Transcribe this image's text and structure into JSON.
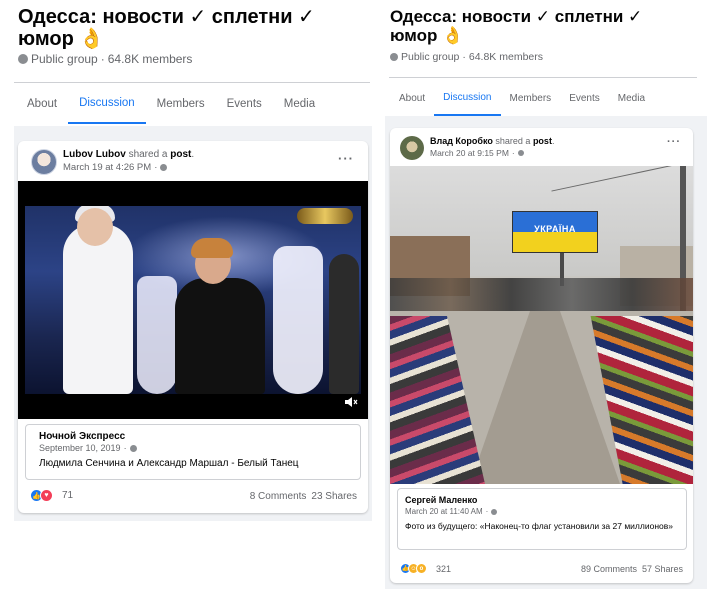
{
  "left": {
    "group": {
      "title": "Одесса: новости ✓ сплетни ✓ юмор 👌",
      "privacy": "Public group",
      "separator": "·",
      "members": "64.8K members"
    },
    "tabs": [
      {
        "label": "About",
        "active": false
      },
      {
        "label": "Discussion",
        "active": true
      },
      {
        "label": "Members",
        "active": false
      },
      {
        "label": "Events",
        "active": false
      },
      {
        "label": "Media",
        "active": false
      }
    ],
    "post": {
      "author": "Lubov Lubov",
      "shared_text": "shared a",
      "post_word": "post",
      "period": ".",
      "time": "March 19 at 4:26 PM",
      "time_separator": "·",
      "more": "···",
      "shared_post": {
        "author": "Ночной Экспресс",
        "date": "September 10, 2019",
        "date_separator": "·",
        "text": "Людмила Сенчина и Александр Маршал - Белый Танец"
      },
      "reactions_count": "71",
      "comments": "8 Comments",
      "shares": "23 Shares"
    }
  },
  "right": {
    "group": {
      "title": "Одесса: новости ✓ сплетни ✓ юмор 👌",
      "privacy": "Public group",
      "separator": "·",
      "members": "64.8K members"
    },
    "tabs": [
      {
        "label": "About",
        "active": false
      },
      {
        "label": "Discussion",
        "active": true
      },
      {
        "label": "Members",
        "active": false
      },
      {
        "label": "Events",
        "active": false
      },
      {
        "label": "Media",
        "active": false
      }
    ],
    "post": {
      "author": "Влад Коробко",
      "shared_text": "shared a",
      "post_word": "post",
      "period": ".",
      "time": "March 20 at 9:15 PM",
      "time_separator": "·",
      "more": "···",
      "photo_billboard_text": "УКРАЇНА",
      "shared_post": {
        "author": "Сергей Маленко",
        "date": "March 20 at 11:40 AM",
        "date_separator": "·",
        "text": "Фото из будущего: «Наконец-то флаг установили за 27 миллионов»"
      },
      "reactions_count": "321",
      "comments": "89 Comments",
      "shares": "57 Shares"
    }
  },
  "colors": {
    "accent": "#1877f2",
    "secondary_text": "#65676b",
    "feed_bg": "#f0f2f5"
  }
}
